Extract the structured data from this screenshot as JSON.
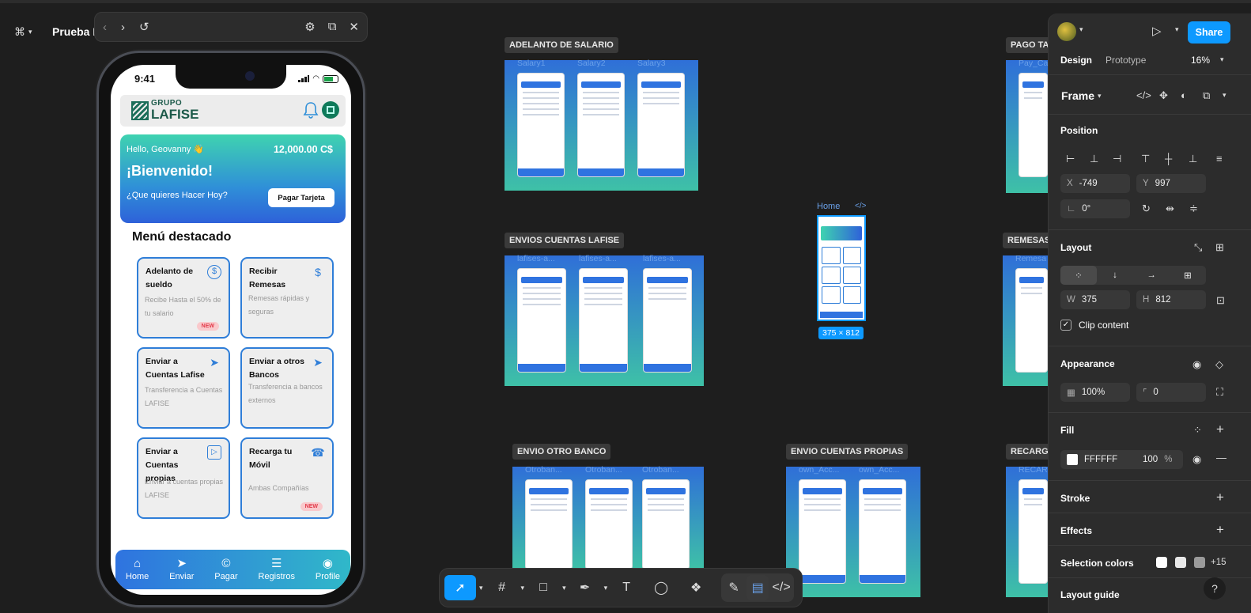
{
  "file_title": "Prueba L",
  "phone": {
    "time": "9:41",
    "logo_top": "GRUPO",
    "logo_bottom": "LAFISE",
    "greeting": "Hello, Geovanny 👋",
    "balance": "12,000.00 C$",
    "welcome": "¡Bienvenido!",
    "question": "¿Que quieres Hacer Hoy?",
    "pay_card": "Pagar Tarjeta",
    "featured_title": "Menú destacado",
    "tiles": [
      {
        "title": "Adelanto de sueldo",
        "desc": "Recibe Hasta el 50% de tu salario",
        "icon": "$",
        "badge": "NEW"
      },
      {
        "title": "Recibir Remesas",
        "desc": "Remesas rápidas y seguras",
        "icon": "$",
        "badge": ""
      },
      {
        "title": "Enviar a Cuentas Lafise",
        "desc": "Transferencia a Cuentas LAFISE",
        "icon": "➤",
        "badge": ""
      },
      {
        "title": "Enviar a otros Bancos",
        "desc": "Transferencia a bancos externos",
        "icon": "➤",
        "badge": ""
      },
      {
        "title": "Enviar a Cuentas propias",
        "desc": "Enviar a cuentas propias LAFISE",
        "icon": "▷",
        "badge": ""
      },
      {
        "title": "Recarga tu Móvil",
        "desc": "Ambas Compañías",
        "icon": "☎",
        "badge": "NEW"
      }
    ],
    "nav": [
      {
        "label": "Home",
        "icon": "⌂"
      },
      {
        "label": "Enviar",
        "icon": "➤"
      },
      {
        "label": "Pagar",
        "icon": "©"
      },
      {
        "label": "Registros",
        "icon": "☰"
      },
      {
        "label": "Profile",
        "icon": "◉"
      }
    ]
  },
  "canvas": {
    "sections": {
      "salary": "ADELANTO DE SALARIO",
      "envios_lafise": "ENVIOS CUENTAS LAFISE",
      "otro_banco": "ENVIO OTRO BANCO",
      "propias": "ENVIO CUENTAS PROPIAS",
      "pago": "PAGO TA",
      "remesas": "REMESAS",
      "recarga": "RECARGA"
    },
    "salary_frames": [
      "Salary1",
      "Salary2",
      "Salary3"
    ],
    "lafise_frames": [
      "lafises-a...",
      "lafises-a...",
      "lafises-a..."
    ],
    "otro_frames": [
      "Otroban...",
      "Otroban...",
      "Otroban..."
    ],
    "propias_frames": [
      "own_Acc...",
      "own_Acc..."
    ],
    "pago_frame": "Pay_Ca",
    "remesas_frame": "Remesa",
    "recarga_frame": "RECAR",
    "home_label": "Home",
    "home_size": "375 × 812"
  },
  "panel": {
    "tabs": {
      "design": "Design",
      "prototype": "Prototype",
      "zoom": "16%"
    },
    "share": "Share",
    "frame_label": "Frame",
    "position": "Position",
    "x_key": "X",
    "x_val": "-749",
    "y_key": "Y",
    "y_val": "997",
    "rotation": "0°",
    "layout": "Layout",
    "w_key": "W",
    "w_val": "375",
    "h_key": "H",
    "h_val": "812",
    "clip": "Clip content",
    "appearance": "Appearance",
    "opacity": "100%",
    "radius": "0",
    "fill": "Fill",
    "fill_hex": "FFFFFF",
    "fill_opacity": "100",
    "fill_pct": "%",
    "stroke": "Stroke",
    "effects": "Effects",
    "selection_colors": "Selection colors",
    "selection_more": "+15",
    "layout_guide": "Layout guide"
  },
  "colors": {
    "accent": "#0d99ff",
    "canvas": "#1e1e1e",
    "panel": "#2c2c2c"
  }
}
